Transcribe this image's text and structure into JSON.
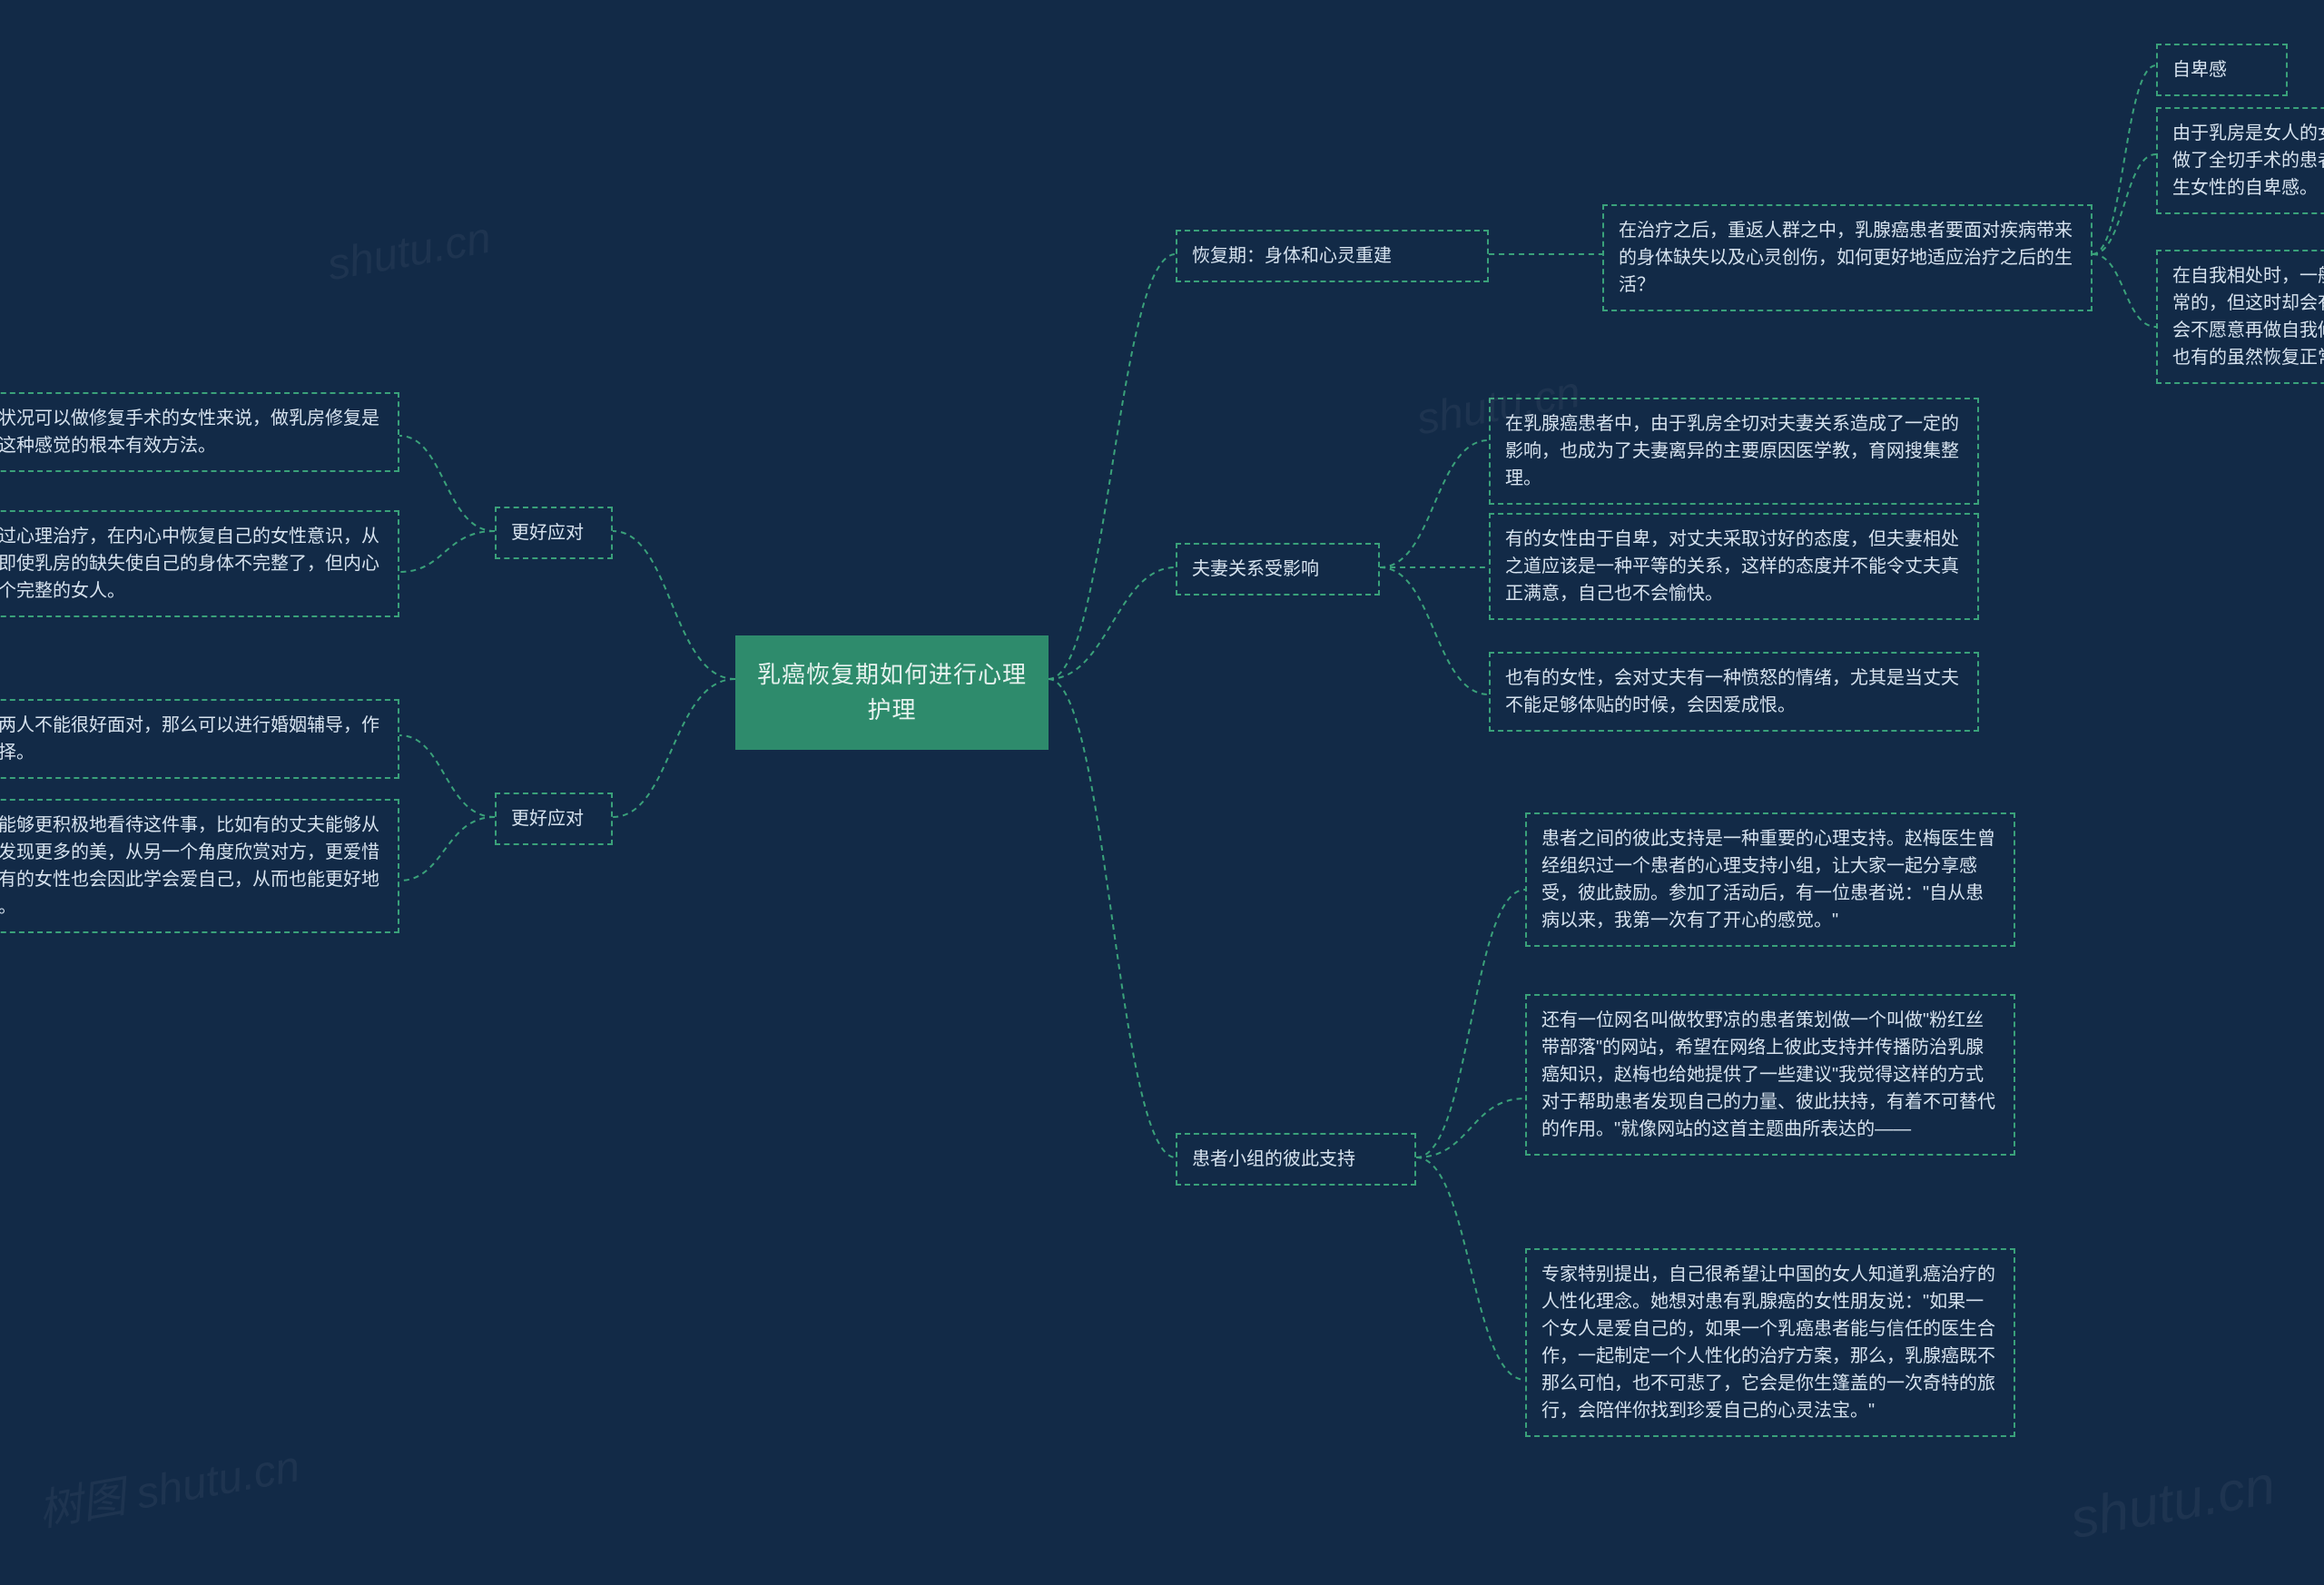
{
  "center": {
    "title": "乳癌恢复期如何进行心理护理"
  },
  "right": {
    "recovery": {
      "label": "恢复期：身体和心灵重建",
      "desc": "在治疗之后，重返人群之中，乳腺癌患者要面对疾病带来的身体缺失以及心灵创伤，如何更好地适应治疗之后的生活？",
      "sub1": "自卑感",
      "sub2": "由于乳房是女人的女性特征，因此患病之后，尤其是那些做了全切手术的患者，会感觉女性的身份受到打击，会产生女性的自卑感。",
      "sub3": "在自我相处时，一般女性本来会有一种自恋状态，这是正常的，但这时却会有一种形体上残缺的自卑感，有的女性会不愿意再做自我修饰，好像放弃了自己的女性身份感。也有的虽然恢复正常的外表，但内心却感觉残缺。"
    },
    "couple": {
      "label": "夫妻关系受影响",
      "sub1": "在乳腺癌患者中，由于乳房全切对夫妻关系造成了一定的影响，也成为了夫妻离异的主要原因医学教，育网搜集整理。",
      "sub2": "有的女性由于自卑，对丈夫采取讨好的态度，但夫妻相处之道应该是一种平等的关系，这样的态度并不能令丈夫真正满意，自己也不会愉快。",
      "sub3": "也有的女性，会对丈夫有一种愤怒的情绪，尤其是当丈夫不能足够体贴的时候，会因爱成恨。"
    },
    "group": {
      "label": "患者小组的彼此支持",
      "sub1": "患者之间的彼此支持是一种重要的心理支持。赵梅医生曾经组织过一个患者的心理支持小组，让大家一起分享感受，彼此鼓励。参加了活动后，有一位患者说：\"自从患病以来，我第一次有了开心的感觉。\"",
      "sub2": "还有一位网名叫做牧野凉的患者策划做一个叫做\"粉红丝带部落\"的网站，希望在网络上彼此支持并传播防治乳腺癌知识，赵梅也给她提供了一些建议\"我觉得这样的方式对于帮助患者发现自己的力量、彼此扶持，有着不可替代的作用。\"就像网站的这首主题曲所表达的——",
      "sub3": "专家特别提出，自己很希望让中国的女人知道乳癌治疗的人性化理念。她想对患有乳腺癌的女性朋友说：\"如果一个女人是爱自己的，如果一个乳癌患者能与信任的医生合作，一起制定一个人性化的治疗方案，那么，乳腺癌既不那么可怕，也不可悲了，它会是你生篷盖的一次奇特的旅行，会陪伴你找到珍爱自己的心灵法宝。\""
    }
  },
  "left": {
    "cope1": {
      "label": "更好应对",
      "sub1": "对于身体状况可以做修复手术的女性来说，做乳房修复是彻底改变这种感觉的根本有效方法。",
      "sub2": "还可以通过心理治疗，在内心中恢复自己的女性意识，从而认识到即使乳房的缺失使自己的身体不完整了，但内心仍然是一个完整的女人。"
    },
    "cope2": {
      "label": "更好应对",
      "sub1": "如果夫妻两人不能很好面对，那么可以进行婚姻辅导，作为一种选择。",
      "sub2": "有的夫妻能够更积极地看待这件事，比如有的丈夫能够从妻子身上发现更多的美，从另一个角度欣赏对方，更爱惜对方。而有的女性也会因此学会爱自己，从而也能更好地面对婚姻。"
    }
  },
  "watermarks": {
    "w1": "shutu.cn",
    "w2": "shutu.cn",
    "w3": "树图 shutu.cn"
  }
}
